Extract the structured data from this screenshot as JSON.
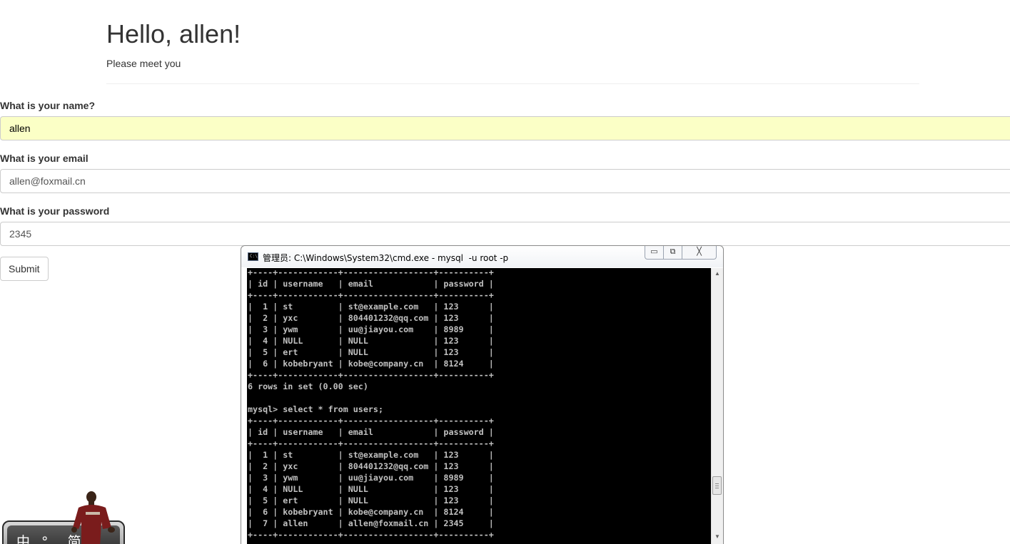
{
  "header": {
    "title": "Hello, allen!",
    "subtitle": "Please meet you"
  },
  "form": {
    "name_label": "What is your name?",
    "name_value": "allen",
    "email_label": "What is your email",
    "email_value": "allen@foxmail.cn",
    "password_label": "What is your password",
    "password_value": "2345",
    "submit_label": "Submit",
    "autofill_color": "#fbffc6"
  },
  "cmd_window": {
    "title": "管理员: C:\\Windows\\System32\\cmd.exe - mysql  -u root -p",
    "minimize_glyph": "▭",
    "restore_glyph": "⧉",
    "close_glyph": "╳",
    "icon_text": "C:\\",
    "scroll_up": "▲",
    "scroll_down": "▼",
    "lines": [
      "+----+------------+------------------+----------+",
      "| id | username   | email            | password |",
      "+----+------------+------------------+----------+",
      "|  1 | st         | st@example.com   | 123      |",
      "|  2 | yxc        | 804401232@qq.com | 123      |",
      "|  3 | ywm        | uu@jiayou.com    | 8989     |",
      "|  4 | NULL       | NULL             | 123      |",
      "|  5 | ert        | NULL             | 123      |",
      "|  6 | kobebryant | kobe@company.cn  | 8124     |",
      "+----+------------+------------------+----------+",
      "6 rows in set (0.00 sec)",
      "",
      "mysql> select * from users;",
      "+----+------------+------------------+----------+",
      "| id | username   | email            | password |",
      "+----+------------+------------------+----------+",
      "|  1 | st         | st@example.com   | 123      |",
      "|  2 | yxc        | 804401232@qq.com | 123      |",
      "|  3 | ywm        | uu@jiayou.com    | 8989     |",
      "|  4 | NULL       | NULL             | 123      |",
      "|  5 | ert        | NULL             | 123      |",
      "|  6 | kobebryant | kobe@company.cn  | 8124     |",
      "|  7 | allen      | allen@foxmail.cn | 2345     |",
      "+----+------------+------------------+----------+"
    ]
  },
  "ime": {
    "text": "中 °, 简"
  }
}
